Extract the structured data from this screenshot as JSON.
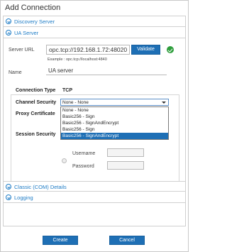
{
  "dialog": {
    "title": "Add Connection"
  },
  "sections": {
    "discovery": "Discovery Server",
    "ua": "UA Server",
    "classic": "Classic (COM) Details",
    "logging": "Logging"
  },
  "server": {
    "url_label": "Server URL",
    "url_value": "opc.tcp://192.168.1.72:48020",
    "validate_label": "Validate",
    "example_text": "Example : opc.tcp://localhost:4840",
    "name_label": "Name",
    "name_value": "UA server"
  },
  "connection": {
    "type_label": "Connection Type",
    "type_value": "TCP",
    "security_label": "Channel Security",
    "security_value": "None - None",
    "options": [
      "None - None",
      "Basic256 - Sign",
      "Basic256 - SignAndEncrypt",
      "Basic256 - Sign",
      "Basic256 - SignAndEncrypt"
    ],
    "selected_option_index": 4,
    "proxy_label": "Proxy Certificate",
    "session_label": "Session Security",
    "username_label": "Username",
    "password_label": "Password"
  },
  "footer": {
    "create": "Create",
    "cancel": "Cancel"
  },
  "colors": {
    "accent": "#1e6fb5",
    "success": "#2e9e3c",
    "section_text": "#1e7cc6"
  }
}
